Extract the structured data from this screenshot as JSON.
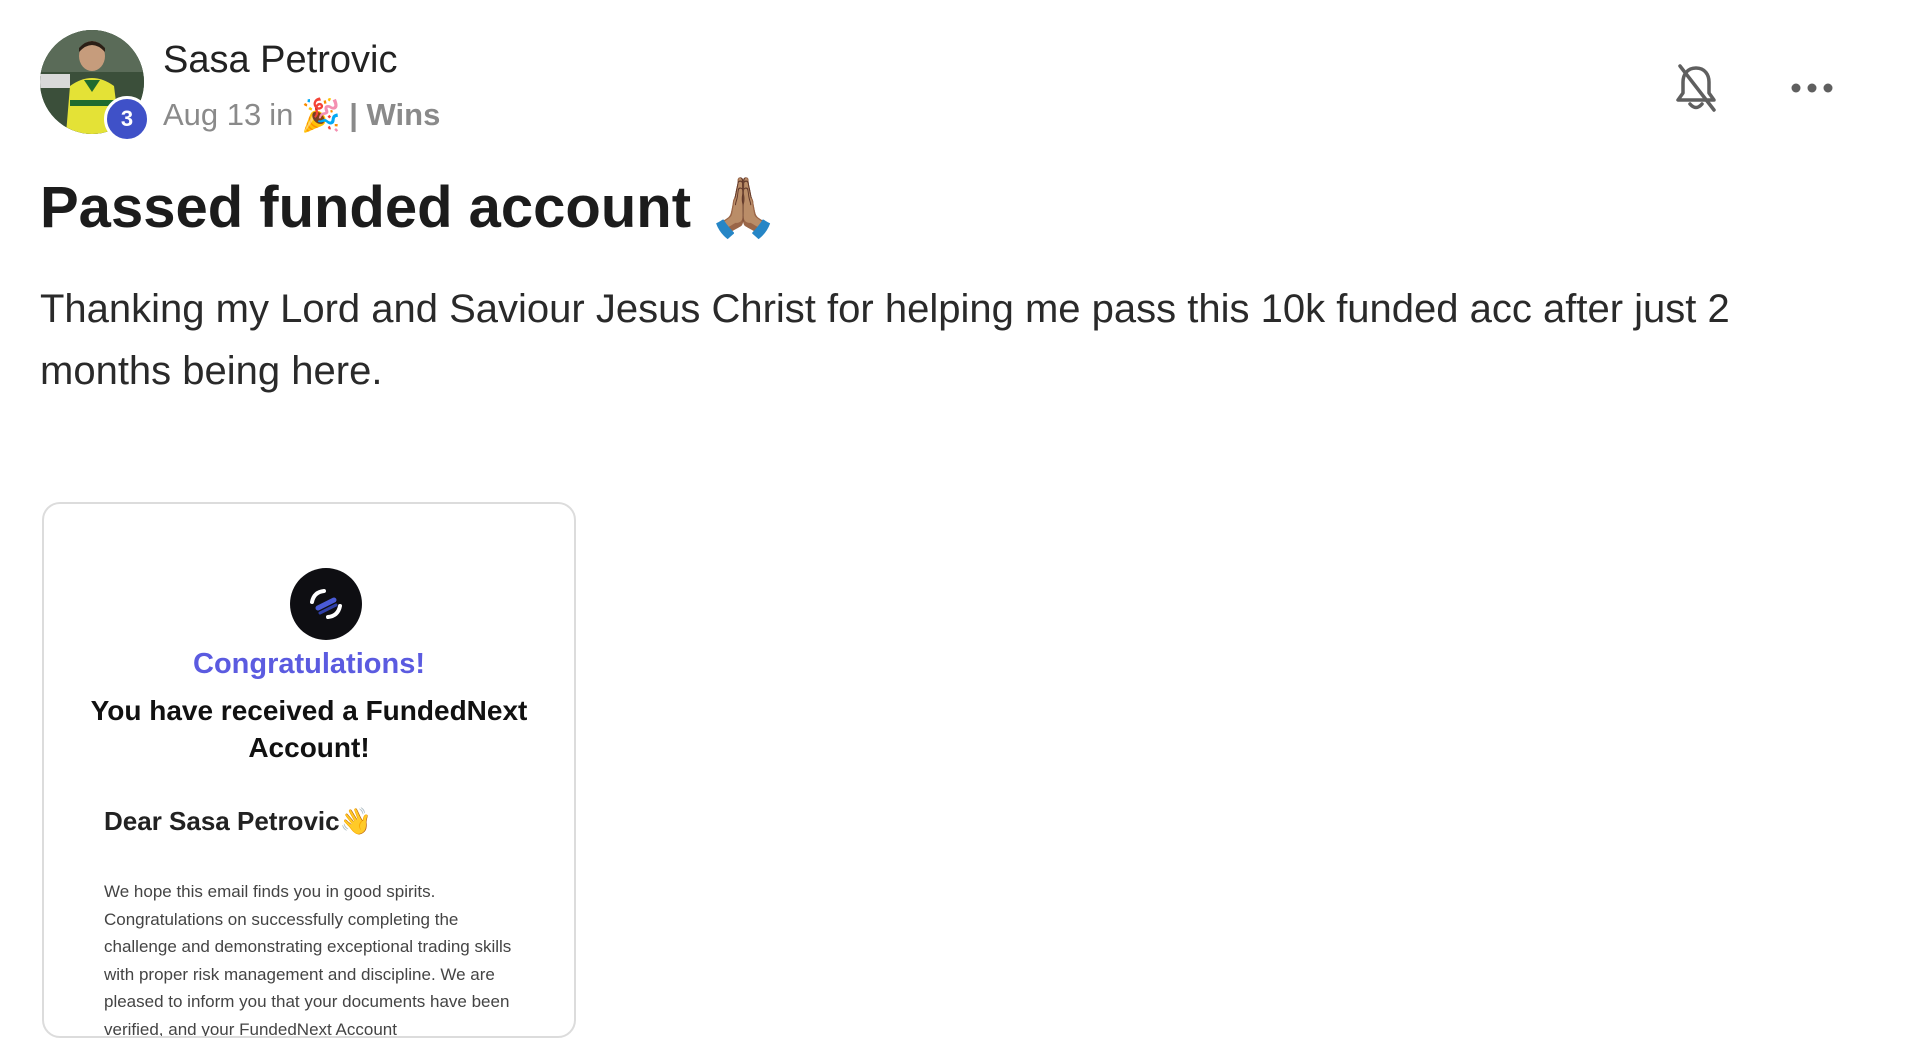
{
  "author": {
    "name": "Sasa Petrovic",
    "level": "3"
  },
  "meta": {
    "date": "Aug 13",
    "in_label": "in",
    "category_emoji": "🎉",
    "category_name": "| Wins"
  },
  "actions": {
    "notifications_icon": "bell-off-icon",
    "more_icon": "more-horizontal-icon"
  },
  "post": {
    "title": "Passed funded account 🙏🏽",
    "body": "Thanking my Lord and Saviour Jesus Christ for helping me pass this 10k funded acc after just 2 months being here."
  },
  "attachment": {
    "congrats": "Congratulations!",
    "heading": "You have received a FundedNext Account!",
    "dear": "Dear Sasa Petrovic👋",
    "text": "We hope this email finds you in good spirits. Congratulations on successfully completing the challenge and demonstrating exceptional trading skills with proper risk management and discipline. We are pleased to inform you that your documents have been verified, and your FundedNext Account"
  },
  "colors": {
    "badge": "#3f51c8",
    "congrats": "#5b5be0",
    "meta_text": "#8a8a8a"
  }
}
